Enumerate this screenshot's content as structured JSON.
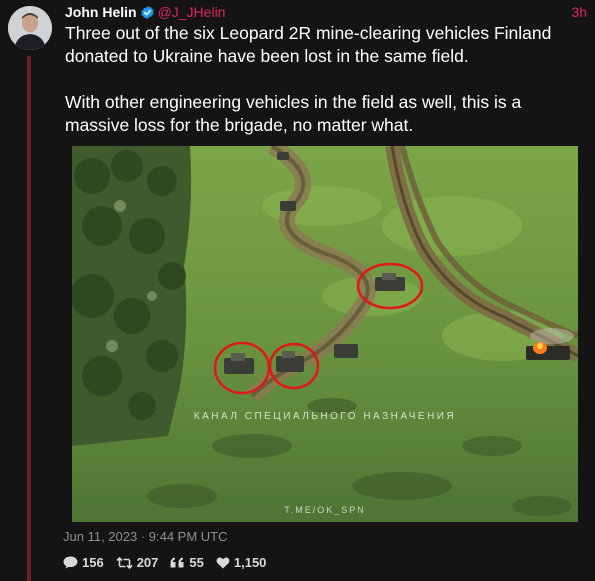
{
  "tweet": {
    "author_name": "John Helin",
    "handle": "@J_JHelin",
    "time_ago": "3h",
    "paragraphs": [
      "Three out of the six Leopard 2R mine-clearing vehicles Finland donated to Ukraine have been lost in the same field.",
      "With other engineering vehicles in the field as well, this is a massive loss for the brigade, no matter what."
    ],
    "image": {
      "watermark_top": "КАНАЛ СПЕЦИАЛЬНОГО НАЗНАЧЕНИЯ",
      "watermark_bottom": "T.ME/OK_SPN"
    },
    "posted_at": "Jun 11, 2023 · 9:44 PM UTC",
    "stats": {
      "replies": "156",
      "retweets": "207",
      "quotes": "55",
      "likes": "1,150"
    }
  },
  "colors": {
    "accent": "#e0245e",
    "verified": "#1d9bf0",
    "background": "#141414",
    "thread_line": "#6e1f1f"
  },
  "icons": [
    "verified-badge-icon",
    "reply-icon",
    "retweet-icon",
    "quote-icon",
    "like-icon"
  ]
}
